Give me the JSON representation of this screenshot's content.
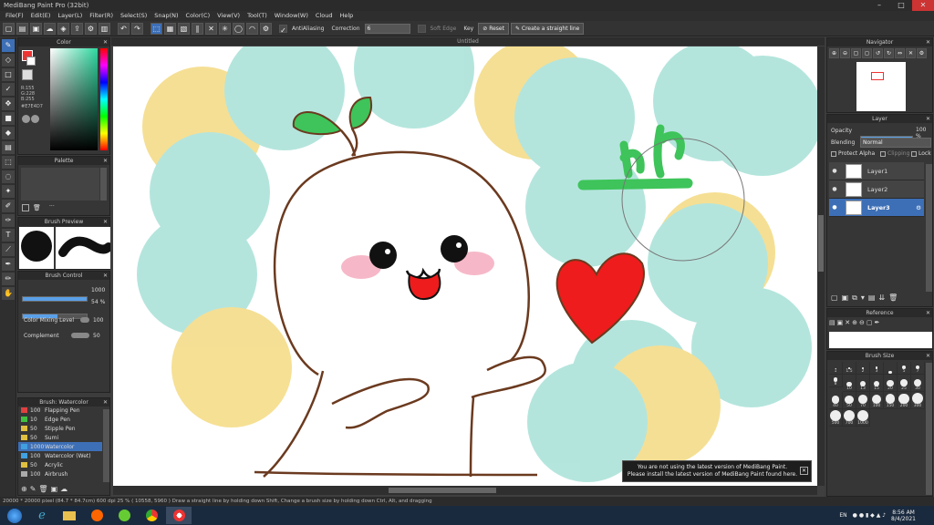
{
  "window": {
    "title": "MediBang Paint Pro (32bit)"
  },
  "menu": [
    "File(F)",
    "Edit(E)",
    "Layer(L)",
    "Filter(R)",
    "Select(S)",
    "Snap(N)",
    "Color(C)",
    "View(V)",
    "Tool(T)",
    "Window(W)",
    "Cloud",
    "Help"
  ],
  "toolbar": {
    "antialiasing_label": "AntiAliasing",
    "correction_label": "Correction",
    "correction_value": "6",
    "soft_edge_label": "Soft Edge",
    "key_label": "Key",
    "reset_label": "Reset",
    "straight_line_label": "Create a straight line"
  },
  "document": {
    "tab_label": "Untitled"
  },
  "color_panel": {
    "title": "Color",
    "r": "R:155",
    "g": "G:228",
    "b": "B:255",
    "hex": "#E7E4D7"
  },
  "palette_panel": {
    "title": "Palette"
  },
  "brush_preview_panel": {
    "title": "Brush Preview"
  },
  "brush_control": {
    "title": "Brush Control",
    "size_value": "1000",
    "opacity_value": "54",
    "opacity_unit": "%",
    "mixing_label": "Color Mixing Level",
    "mixing_value": "100",
    "complement_label": "Complement",
    "complement_value": "50"
  },
  "brush_list": {
    "title": "Brush: Watercolor",
    "items": [
      {
        "size": "100",
        "name": "Flapping Pen",
        "color": "#e04040"
      },
      {
        "size": "10",
        "name": "Edge Pen",
        "color": "#40c040"
      },
      {
        "size": "50",
        "name": "Stipple Pen",
        "color": "#e0c040"
      },
      {
        "size": "50",
        "name": "Sumi",
        "color": "#e0c040"
      },
      {
        "size": "1000",
        "name": "Watercolor",
        "color": "#40a0e0",
        "selected": true
      },
      {
        "size": "100",
        "name": "Watercolor (Wet)",
        "color": "#40a0e0"
      },
      {
        "size": "50",
        "name": "Acrylic",
        "color": "#e0c040"
      },
      {
        "size": "100",
        "name": "Airbrush",
        "color": "#aaaaaa"
      }
    ]
  },
  "navigator": {
    "title": "Navigator"
  },
  "layer_panel": {
    "title": "Layer",
    "opacity_label": "Opacity",
    "opacity_value": "100",
    "opacity_unit": "%",
    "blending_label": "Blending",
    "blending_value": "Normal",
    "protect_alpha_label": "Protect Alpha",
    "clipping_label": "Clipping",
    "lock_label": "Lock",
    "layers": [
      {
        "name": "Layer1"
      },
      {
        "name": "Layer2"
      },
      {
        "name": "Layer3",
        "selected": true
      }
    ]
  },
  "reference_panel": {
    "title": "Reference"
  },
  "brush_size_panel": {
    "title": "Brush Size",
    "sizes": [
      "1",
      "1.5",
      "2",
      "3",
      "",
      "5",
      "7",
      "8",
      "10",
      "13",
      "15",
      "20",
      "25",
      "30",
      "40",
      "50",
      "70",
      "100",
      "150",
      "200",
      "300",
      "500",
      "700",
      "1000"
    ]
  },
  "notice": {
    "line1": "You are not using the latest version of MediBang Paint.",
    "line2": "Please install the latest version of MediBang Paint found here."
  },
  "status": {
    "text": "20000 * 20000 pixel  (84.7 * 84.7cm)  600 dpi  25 %  ( 10558, 5960 )  Draw a straight line by holding down Shift, Change a brush size by holding down Ctrl, Alt, and dragging"
  },
  "taskbar": {
    "lang": "EN",
    "time": "8:56 AM",
    "date": "8/4/2021"
  },
  "colors": {
    "accent": "#3d6fb6",
    "yellow": "#f1cf5b",
    "teal": "#8dd8cc",
    "heart": "#ee1c1c",
    "leaf": "#3ec45a",
    "outline": "#6b3a1f"
  }
}
